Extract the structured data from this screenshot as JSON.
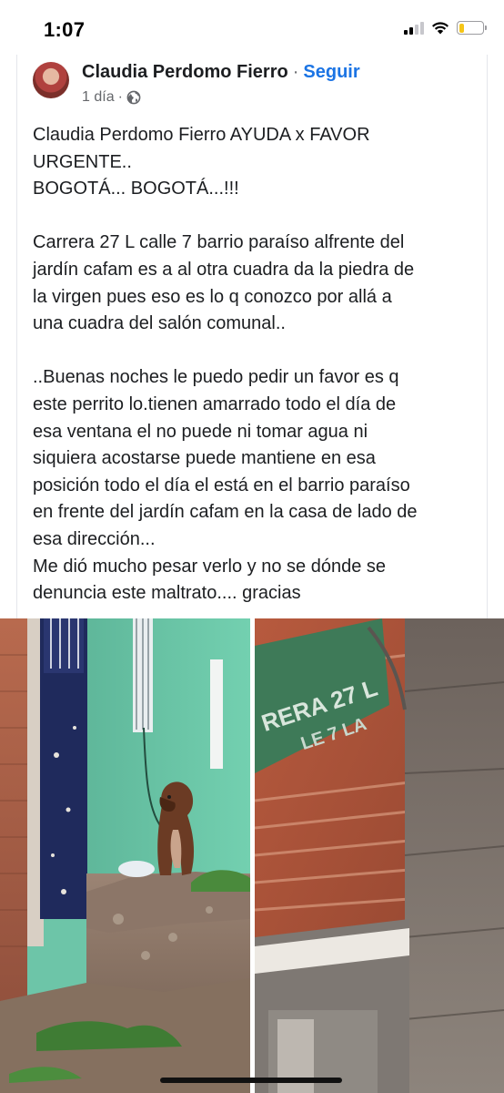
{
  "status_bar": {
    "time": "1:07",
    "battery_color": "#f5c518",
    "battery_level": 0.2,
    "icons": [
      "signal-icon",
      "wifi-icon",
      "battery-icon"
    ]
  },
  "post": {
    "author": "Claudia Perdomo Fierro",
    "separator": "·",
    "follow_label": "Seguir",
    "time": "1 día",
    "dot": "·",
    "privacy_icon": "globe-icon",
    "lines": [
      "Claudia Perdomo Fierro AYUDA x FAVOR",
      "URGENTE..",
      "BOGOTÁ... BOGOTÁ...!!!",
      "",
      "Carrera 27 L  calle 7 barrio paraíso alfrente del",
      "jardín cafam es a al otra cuadra da la piedra de",
      "la virgen pues eso es lo q conozco por allá a",
      "una cuadra del salón comunal..",
      "",
      "..Buenas noches le puedo pedir un favor es q",
      "este perrito lo.tienen amarrado todo el día de",
      "esa ventana el no puede ni tomar agua ni",
      "siquiera acostarse puede mantiene en esa",
      "posición todo el día el está en el barrio paraíso",
      "en frente del jardín cafam en la casa de lado de",
      "esa dirección...",
      "Me dió mucho pesar verlo y no se dónde se",
      "denuncia este maltrato.... gracias"
    ],
    "accent_color": "#1b74e4"
  },
  "photos": {
    "right_sign_text": "RERA 27 L",
    "right_sign_text_2": "LE 7 LA"
  }
}
